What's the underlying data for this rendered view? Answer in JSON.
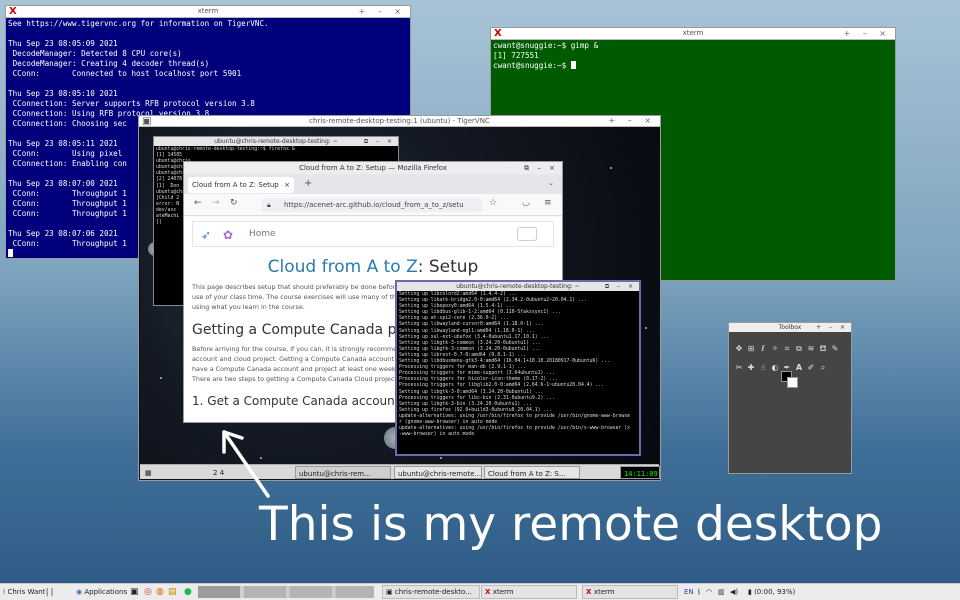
{
  "xterm1": {
    "title": "xterm",
    "lines": [
      "See https://www.tigervnc.org for information on TigerVNC.",
      "",
      "Thu Sep 23 08:05:09 2021",
      " DecodeManager: Detected 8 CPU core(s)",
      " DecodeManager: Creating 4 decoder thread(s)",
      " CConn:       Connected to host localhost port 5901",
      "",
      "Thu Sep 23 08:05:10 2021",
      " CConnection: Server supports RFB protocol version 3.8",
      " CConnection: Using RFB protocol version 3.8",
      " CConnection: Choosing sec",
      "",
      "Thu Sep 23 08:05:11 2021",
      " CConn:       Using pixel",
      " CConnection: Enabling con",
      "",
      "Thu Sep 23 08:07:00 2021",
      " CConn:       Throughput 1",
      " CConn:       Throughput 1",
      " CConn:       Throughput 1",
      "",
      "Thu Sep 23 08:07:06 2021",
      " CConn:       Throughput 1"
    ]
  },
  "xterm2": {
    "title": "xterm",
    "lines": [
      "cwant@snuggie:~$ gimp &",
      "[1] 727551",
      "cwant@snuggie:~$ "
    ]
  },
  "vnc": {
    "title": "chris-remote-desktop-testing:1 (ubuntu) - TigerVNC",
    "bg_term_title": "ubuntu@chris-remote-desktop-testing: ~",
    "bg_term_lines": [
      "ubuntu@chris-remote-desktop-testing:~$ firefox &",
      "[1] 14585",
      "ubuntu@chris",
      "ubuntu@chris",
      "ubuntu@chris",
      "[2] 24078",
      "[1]  Don",
      "ubuntu@chris",
      "[Child 2",
      "error: N",
      "dev/avc",
      "ateMachi",
      "[]"
    ],
    "taskbar": {
      "workspaces": [
        "2",
        "4"
      ],
      "items": [
        "ubuntu@chris-rem...",
        "ubuntu@chris-remote...",
        "Cloud from A to Z: S..."
      ],
      "clock": "14:11:09"
    }
  },
  "firefox": {
    "window_title": "Cloud from A to Z: Setup — Mozilla Firefox",
    "tab_label": "Cloud from A to Z: Setup",
    "new_tab": "+",
    "url": "https://acenet-arc.github.io/cloud_from_a_to_z/setu",
    "nav_home": "Home",
    "heading_part1": "Cloud from A to Z",
    "heading_part2": ": Setup",
    "intro": "This page describes setup that should preferably be done before the course begins in order to make the best use of your class time. The course exercises will use many of the same tools as to better allow you to continue using what you learn in the course.",
    "h2": "Getting a Compute Canada project",
    "body": "Before arriving for the course, if you can, it is strongly recommended that you obtain a Compute Canada account and cloud project. Getting a Compute Canada account can take two business days each. Ensuring you have a Compute Canada account and project at least one week before the course begins is recommended. There are two steps to getting a Compute Canada Cloud project:",
    "list_item": "1. Get a Compute Canada account"
  },
  "term3": {
    "title": "ubuntu@chris-remote-desktop-testing: ~",
    "lines": [
      "Setting up libcolord2:amd64 (1.4.4-2) ...",
      "Setting up libatk-bridge2.0-0:amd64 (2.34.2-0ubuntu2~20.04.1) ...",
      "Setting up libepoxy0:amd64 (1.5.4-1) ...",
      "Setting up libdbus-glib-1-2:amd64 (0.110-5fakssync1) ...",
      "Setting up at-spi2-core (2.36.0-2) ...",
      "Setting up libwayland-cursor0:amd64 (1.18.0-1) ...",
      "Setting up libwayland-egl1:amd64 (1.18.0-1) ...",
      "Setting up xul-ext-ubufox (3.4-0ubuntu1.17.10.1) ...",
      "Setting up libgtk-3-common (3.24.20-0ubuntu1) ...",
      "Setting up libgtk-3-common (3.24.20-0ubuntu1) ...",
      "Setting up librest-0.7-0:amd64 (0.8.1-1) ...",
      "Setting up libdbusmenu-gtk3-4:amd64 (16.04.1+18.10.20180917-0ubuntu6) ...",
      "Processing triggers for man-db (2.9.1-1) ...",
      "Processing triggers for mime-support (3.64ubuntu1) ...",
      "Processing triggers for hicolor-icon-theme (0.17-2) ...",
      "Processing triggers for libglib2.0-0:amd64 (2.64.6-1~ubuntu20.04.4) ...",
      "Setting up libgtk-3-0:amd64 (3.24.20-0ubuntu1) ...",
      "Processing triggers for libc-bin (2.31-0ubuntu9.2) ...",
      "Setting up libgtk-3-bin (3.24.20-0ubuntu1) ...",
      "Setting up firefox (92.0+build3-0ubuntu0.20.04.1) ...",
      "update-alternatives: using /usr/bin/firefox to provide /usr/bin/gnome-www-browse",
      "r (gnome-www-browser) in auto mode",
      "update-alternatives: using /usr/bin/firefox to provide /usr/bin/x-www-browser (x",
      "-www-browser) in auto mode"
    ]
  },
  "toolbox": {
    "title": "Toolbox"
  },
  "caption": "This is my remote desktop",
  "taskbar": {
    "user": "Chris Want",
    "applications": "Applications",
    "items": [
      "chris-remote-deskto...",
      "xterm",
      "xterm"
    ],
    "lang": "EN",
    "battery": "(0:00, 93%)"
  },
  "colors": {
    "xterm_blue": "#00007c",
    "xterm_green": "#005b00",
    "link_blue": "#2a7ab0"
  }
}
